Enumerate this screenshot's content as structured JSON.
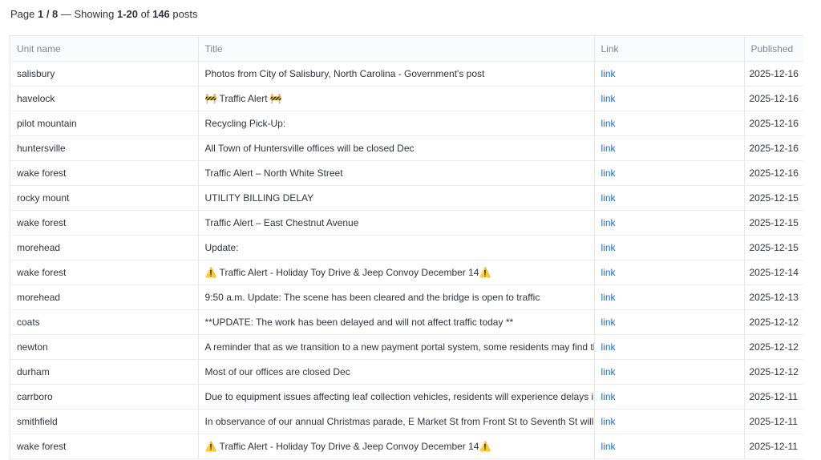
{
  "summary": {
    "page_label": "Page ",
    "page_value": "1 / 8",
    "showing_prefix": " — Showing ",
    "range": "1-20",
    "of_text": " of ",
    "total": "146",
    "suffix": " posts"
  },
  "table": {
    "columns": [
      "Unit name",
      "Title",
      "Link",
      "Published"
    ],
    "rows": [
      {
        "unit": "salisbury",
        "title": "Photos from City of Salisbury, North Carolina - Government's post",
        "link": "link",
        "published": "2025-12-16"
      },
      {
        "unit": "havelock",
        "title": "🚧 Traffic Alert 🚧",
        "link": "link",
        "published": "2025-12-16"
      },
      {
        "unit": "pilot mountain",
        "title": "Recycling Pick-Up:",
        "link": "link",
        "published": "2025-12-16"
      },
      {
        "unit": "huntersville",
        "title": "All Town of Huntersville offices will be closed Dec",
        "link": "link",
        "published": "2025-12-16"
      },
      {
        "unit": "wake forest",
        "title": "Traffic Alert – North White Street",
        "link": "link",
        "published": "2025-12-16"
      },
      {
        "unit": "rocky mount",
        "title": "UTILITY BILLING DELAY",
        "link": "link",
        "published": "2025-12-15"
      },
      {
        "unit": "wake forest",
        "title": "Traffic Alert – East Chestnut Avenue",
        "link": "link",
        "published": "2025-12-15"
      },
      {
        "unit": "morehead",
        "title": "Update:",
        "link": "link",
        "published": "2025-12-15"
      },
      {
        "unit": "wake forest",
        "title": "⚠️ Traffic Alert - Holiday Toy Drive & Jeep Convoy December 14⚠️",
        "link": "link",
        "published": "2025-12-14"
      },
      {
        "unit": "morehead",
        "title": "9:50 a.m. Update: The scene has been cleared and the bridge is open to traffic",
        "link": "link",
        "published": "2025-12-13"
      },
      {
        "unit": "coats",
        "title": "**UPDATE: The work has been delayed and will not affect traffic today **",
        "link": "link",
        "published": "2025-12-12"
      },
      {
        "unit": "newton",
        "title": "A reminder that as we transition to a new payment portal system, some residents may find their",
        "link": "link",
        "published": "2025-12-12"
      },
      {
        "unit": "durham",
        "title": "Most of our offices are closed Dec",
        "link": "link",
        "published": "2025-12-12"
      },
      {
        "unit": "carrboro",
        "title": "Due to equipment issues affecting leaf collection vehicles, residents will experience delays in lea",
        "link": "link",
        "published": "2025-12-11"
      },
      {
        "unit": "smithfield",
        "title": "In observance of our annual Christmas parade, E Market St from Front St to Seventh St will be clo",
        "link": "link",
        "published": "2025-12-11"
      },
      {
        "unit": "wake forest",
        "title": "⚠️ Traffic Alert - Holiday Toy Drive & Jeep Convoy December 14⚠️",
        "link": "link",
        "published": "2025-12-11"
      }
    ]
  }
}
